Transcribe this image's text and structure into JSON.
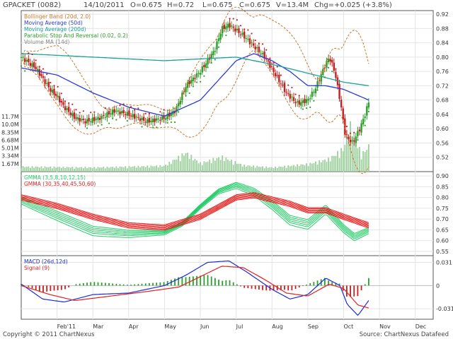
{
  "header": {
    "symbol": "GPACKET (0082)",
    "date": "14/10/2011",
    "open": "O=0.675",
    "high": "H=0.72",
    "low": "L=0.675",
    "close": "C=0.675",
    "volume": "V=13.4M",
    "change": "Chg=+0.025 (+3.8%)"
  },
  "footer": {
    "copyright": "Copyright © 2011 ChartNexus",
    "source": "Source: ChartNexus Datafeed"
  },
  "colors": {
    "up_candle": "#2aa02a",
    "down_candle": "#c81e1e",
    "bollinger": "#c8782a",
    "ma50": "#2a3cd8",
    "ma200": "#1aa29a",
    "sar": "#2aa02a",
    "volume_ma": "#888888",
    "gmma_short": "#22cc66",
    "gmma_long": "#e02020",
    "macd": "#1a2ae0",
    "signal": "#e02020"
  },
  "chart_data": [
    {
      "type": "candlestick",
      "title": "GPACKET (0082)",
      "legend": [
        "Bollinger Band (20d, 2.0)",
        "Moving Average (50d)",
        "Moving Average (200d)",
        "Parabolic Stop And Reversal (0.02, 0.2)",
        "Volume MA (14d)"
      ],
      "y_ticks": [
        0.52,
        0.56,
        0.6,
        0.64,
        0.68,
        0.72,
        0.76,
        0.8,
        0.84,
        0.88,
        0.92
      ],
      "ylim": [
        0.48,
        0.93
      ],
      "volume_ticks": [
        "1.67M",
        "3.34M",
        "5.01M",
        "6.68M",
        "8.35M",
        "10.0M",
        "11.7M"
      ],
      "volume_max": 11.7,
      "x_labels": [
        "Feb'11",
        "Mar",
        "Apr",
        "May",
        "Jun",
        "Jul",
        "Aug",
        "Sep",
        "Oct",
        "Nov",
        "Dec"
      ],
      "x_months": [
        1,
        2,
        3,
        4,
        5,
        6,
        7,
        8,
        9,
        10,
        11
      ],
      "x_range": [
        0,
        11.5
      ],
      "close_profile": [
        [
          0.0,
          0.8
        ],
        [
          0.4,
          0.77
        ],
        [
          0.8,
          0.71
        ],
        [
          1.0,
          0.69
        ],
        [
          1.2,
          0.66
        ],
        [
          1.5,
          0.63
        ],
        [
          1.8,
          0.62
        ],
        [
          2.2,
          0.63
        ],
        [
          2.6,
          0.65
        ],
        [
          3.0,
          0.64
        ],
        [
          3.5,
          0.62
        ],
        [
          4.0,
          0.63
        ],
        [
          4.3,
          0.65
        ],
        [
          4.6,
          0.72
        ],
        [
          5.0,
          0.76
        ],
        [
          5.4,
          0.82
        ],
        [
          5.6,
          0.88
        ],
        [
          5.8,
          0.89
        ],
        [
          6.2,
          0.86
        ],
        [
          6.5,
          0.83
        ],
        [
          6.8,
          0.8
        ],
        [
          7.1,
          0.75
        ],
        [
          7.4,
          0.7
        ],
        [
          7.7,
          0.67
        ],
        [
          8.0,
          0.68
        ],
        [
          8.2,
          0.71
        ],
        [
          8.45,
          0.77
        ],
        [
          8.6,
          0.8
        ],
        [
          8.75,
          0.76
        ],
        [
          8.9,
          0.68
        ],
        [
          9.05,
          0.58
        ],
        [
          9.25,
          0.56
        ],
        [
          9.45,
          0.6
        ],
        [
          9.6,
          0.64
        ],
        [
          9.7,
          0.675
        ]
      ],
      "ma50_profile": [
        [
          0.0,
          0.77
        ],
        [
          1.0,
          0.75
        ],
        [
          2.0,
          0.7
        ],
        [
          3.0,
          0.66
        ],
        [
          4.0,
          0.635
        ],
        [
          5.0,
          0.68
        ],
        [
          6.0,
          0.79
        ],
        [
          6.5,
          0.81
        ],
        [
          7.0,
          0.79
        ],
        [
          7.5,
          0.76
        ],
        [
          8.0,
          0.72
        ],
        [
          8.5,
          0.72
        ],
        [
          9.0,
          0.71
        ],
        [
          9.7,
          0.68
        ]
      ],
      "ma200_profile": [
        [
          0.0,
          0.81
        ],
        [
          2.0,
          0.8
        ],
        [
          4.0,
          0.79
        ],
        [
          5.0,
          0.795
        ],
        [
          6.0,
          0.8
        ],
        [
          7.0,
          0.78
        ],
        [
          8.0,
          0.755
        ],
        [
          9.0,
          0.73
        ],
        [
          9.7,
          0.72
        ]
      ],
      "volume_profile": [
        [
          0.0,
          1.2
        ],
        [
          2.0,
          1.0
        ],
        [
          4.0,
          1.4
        ],
        [
          4.6,
          4.5
        ],
        [
          5.0,
          2.0
        ],
        [
          5.6,
          3.5
        ],
        [
          6.2,
          1.5
        ],
        [
          7.0,
          1.0
        ],
        [
          8.0,
          1.8
        ],
        [
          8.6,
          3.0
        ],
        [
          9.0,
          5.5
        ],
        [
          9.2,
          11.0
        ],
        [
          9.5,
          4.0
        ],
        [
          9.7,
          6.0
        ]
      ]
    },
    {
      "type": "line",
      "legend": [
        "GMMA (3,5,8,10,12,15)",
        "GMMA (30,35,40,45,50,60)"
      ],
      "y_ticks": [
        0.55,
        0.6,
        0.65,
        0.7,
        0.75,
        0.8,
        0.85,
        0.9
      ],
      "ylim": [
        0.53,
        0.92
      ],
      "short_center": [
        [
          0.0,
          0.79
        ],
        [
          1.0,
          0.72
        ],
        [
          2.0,
          0.65
        ],
        [
          3.0,
          0.635
        ],
        [
          4.0,
          0.64
        ],
        [
          4.5,
          0.68
        ],
        [
          5.0,
          0.76
        ],
        [
          5.5,
          0.83
        ],
        [
          6.0,
          0.86
        ],
        [
          6.5,
          0.83
        ],
        [
          7.0,
          0.77
        ],
        [
          7.5,
          0.7
        ],
        [
          8.0,
          0.68
        ],
        [
          8.5,
          0.75
        ],
        [
          9.0,
          0.66
        ],
        [
          9.3,
          0.62
        ],
        [
          9.7,
          0.65
        ]
      ],
      "long_center": [
        [
          0.0,
          0.8
        ],
        [
          1.0,
          0.76
        ],
        [
          2.0,
          0.71
        ],
        [
          3.0,
          0.67
        ],
        [
          4.0,
          0.66
        ],
        [
          5.0,
          0.71
        ],
        [
          6.0,
          0.8
        ],
        [
          6.5,
          0.81
        ],
        [
          7.0,
          0.79
        ],
        [
          7.5,
          0.77
        ],
        [
          8.0,
          0.74
        ],
        [
          8.5,
          0.74
        ],
        [
          9.0,
          0.71
        ],
        [
          9.7,
          0.67
        ]
      ]
    },
    {
      "type": "line",
      "legend": [
        "MACD (26d,12d)",
        "Signal (9)"
      ],
      "y_ticks": [
        -0.031,
        0,
        0.031
      ],
      "ylim": [
        -0.045,
        0.04
      ],
      "macd_profile": [
        [
          0.0,
          0.002
        ],
        [
          0.6,
          -0.018
        ],
        [
          1.2,
          -0.022
        ],
        [
          2.0,
          -0.012
        ],
        [
          3.0,
          -0.01
        ],
        [
          4.0,
          0.0
        ],
        [
          4.6,
          0.014
        ],
        [
          5.2,
          0.031
        ],
        [
          5.8,
          0.033
        ],
        [
          6.3,
          0.018
        ],
        [
          7.0,
          -0.005
        ],
        [
          7.5,
          -0.018
        ],
        [
          8.0,
          -0.012
        ],
        [
          8.5,
          0.01
        ],
        [
          8.9,
          0.0
        ],
        [
          9.1,
          -0.025
        ],
        [
          9.4,
          -0.04
        ],
        [
          9.7,
          -0.02
        ]
      ],
      "signal_profile": [
        [
          0.0,
          0.0
        ],
        [
          0.8,
          -0.012
        ],
        [
          1.5,
          -0.02
        ],
        [
          2.5,
          -0.014
        ],
        [
          3.5,
          -0.008
        ],
        [
          4.4,
          -0.002
        ],
        [
          5.0,
          0.012
        ],
        [
          5.6,
          0.026
        ],
        [
          6.2,
          0.024
        ],
        [
          6.8,
          0.008
        ],
        [
          7.4,
          -0.01
        ],
        [
          8.0,
          -0.014
        ],
        [
          8.6,
          0.002
        ],
        [
          9.0,
          -0.004
        ],
        [
          9.4,
          -0.026
        ],
        [
          9.7,
          -0.03
        ]
      ]
    }
  ]
}
